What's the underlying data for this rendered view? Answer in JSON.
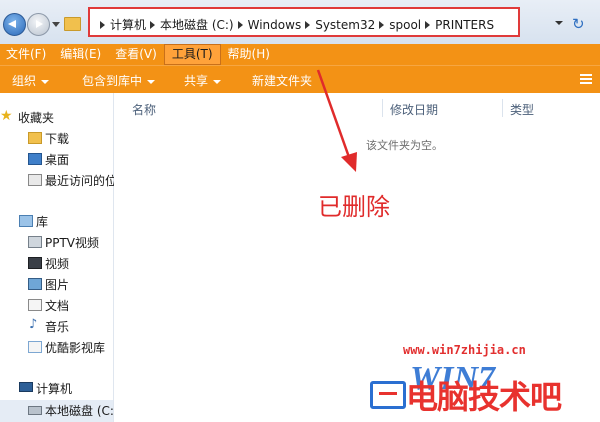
{
  "address": {
    "crumbs": [
      "计算机",
      "本地磁盘 (C:)",
      "Windows",
      "System32",
      "spool",
      "PRINTERS"
    ]
  },
  "menubar": {
    "items": [
      "文件(F)",
      "编辑(E)",
      "查看(V)",
      "工具(T)",
      "帮助(H)"
    ],
    "active_index": 3
  },
  "commandbar": {
    "organize": "组织",
    "include": "包含到库中",
    "share": "共享",
    "new_folder": "新建文件夹"
  },
  "navpane": {
    "favorites": {
      "label": "收藏夹",
      "items": [
        "下载",
        "桌面",
        "最近访问的位"
      ]
    },
    "libraries": {
      "label": "库",
      "items": [
        "PPTV视频",
        "视频",
        "图片",
        "文档",
        "音乐",
        "优酷影视库"
      ]
    },
    "computer": {
      "label": "计算机",
      "items": [
        "本地磁盘 (C:"
      ]
    }
  },
  "content": {
    "columns": [
      "名称",
      "修改日期",
      "类型"
    ],
    "empty_message": "该文件夹为空。"
  },
  "annotation": {
    "text": "已删除",
    "color": "#e02b2b"
  },
  "watermark": {
    "url": "www.win7zhijia.cn",
    "logo": "WIN7",
    "brand": "电脑技术吧"
  },
  "colors": {
    "accent": "#f39215",
    "highlight_border": "#e03a3a"
  }
}
